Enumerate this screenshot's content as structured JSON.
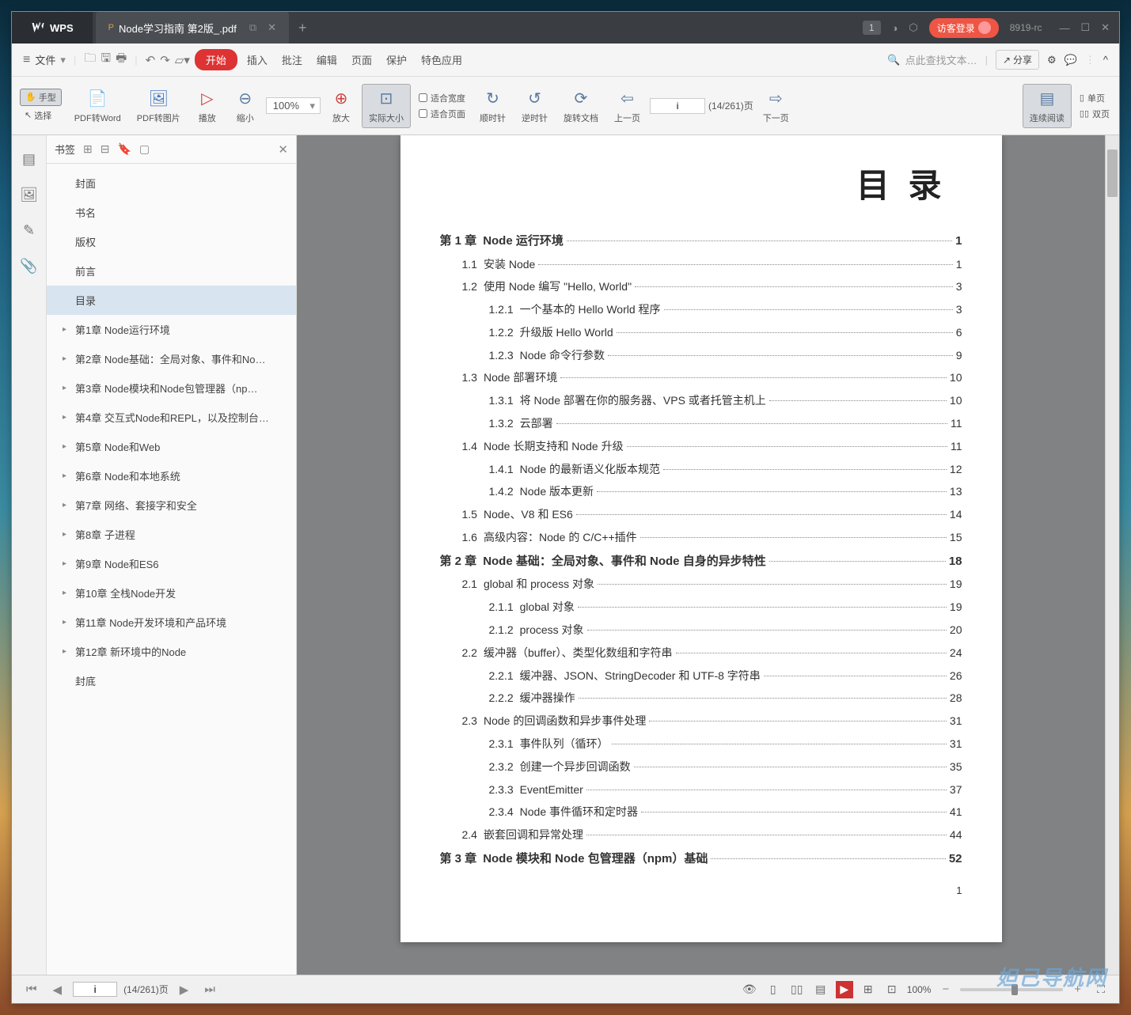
{
  "app": {
    "name": "WPS",
    "version": "8919-rc"
  },
  "tab": {
    "icon": "P",
    "title": "Node学习指南 第2版_.pdf"
  },
  "titlebar": {
    "badge": "1",
    "login": "访客登录"
  },
  "menubar": {
    "file": "文件",
    "start": "开始",
    "insert": "插入",
    "comment": "批注",
    "edit": "编辑",
    "page": "页面",
    "protect": "保护",
    "special": "特色应用",
    "search_ph": "点此查找文本…",
    "share": "分享"
  },
  "toolbar": {
    "hand": "手型",
    "select": "选择",
    "pdf2word": "PDF转Word",
    "pdf2img": "PDF转图片",
    "play": "播放",
    "shrink": "缩小",
    "zoom": "100%",
    "enlarge": "放大",
    "actual": "实际大小",
    "fit_width": "适合宽度",
    "fit_page": "适合页面",
    "cw": "顺时针",
    "ccw": "逆时针",
    "rotate": "旋转文档",
    "prev": "上一页",
    "next": "下一页",
    "page_input": "i",
    "page_info": "(14/261)页",
    "continuous": "连续阅读",
    "single": "单页",
    "double": "双页"
  },
  "sidebar": {
    "title": "书签",
    "items": [
      {
        "label": "封面",
        "exp": false
      },
      {
        "label": "书名",
        "exp": false
      },
      {
        "label": "版权",
        "exp": false
      },
      {
        "label": "前言",
        "exp": false
      },
      {
        "label": "目录",
        "exp": false,
        "active": true
      },
      {
        "label": "第1章 Node运行环境",
        "exp": true
      },
      {
        "label": "第2章 Node基础：全局对象、事件和No…",
        "exp": true
      },
      {
        "label": "第3章 Node模块和Node包管理器（np…",
        "exp": true
      },
      {
        "label": "第4章 交互式Node和REPL，以及控制台…",
        "exp": true
      },
      {
        "label": "第5章 Node和Web",
        "exp": true
      },
      {
        "label": "第6章 Node和本地系统",
        "exp": true
      },
      {
        "label": "第7章 网络、套接字和安全",
        "exp": true
      },
      {
        "label": "第8章 子进程",
        "exp": true
      },
      {
        "label": "第9章 Node和ES6",
        "exp": true
      },
      {
        "label": "第10章 全栈Node开发",
        "exp": true
      },
      {
        "label": "第11章 Node开发环境和产品环境",
        "exp": true
      },
      {
        "label": "第12章 新环境中的Node",
        "exp": true
      },
      {
        "label": "封底",
        "exp": false
      }
    ]
  },
  "doc": {
    "heading": "目 录",
    "toc": [
      {
        "l": 0,
        "n": "第 1 章",
        "t": "Node 运行环境",
        "p": "1"
      },
      {
        "l": 1,
        "n": "1.1",
        "t": "安装 Node",
        "p": "1"
      },
      {
        "l": 1,
        "n": "1.2",
        "t": "使用 Node 编写 \"Hello, World\"",
        "p": "3"
      },
      {
        "l": 2,
        "n": "1.2.1",
        "t": "一个基本的 Hello World 程序",
        "p": "3"
      },
      {
        "l": 2,
        "n": "1.2.2",
        "t": "升级版 Hello World",
        "p": "6"
      },
      {
        "l": 2,
        "n": "1.2.3",
        "t": "Node 命令行参数",
        "p": "9"
      },
      {
        "l": 1,
        "n": "1.3",
        "t": "Node 部署环境",
        "p": "10"
      },
      {
        "l": 2,
        "n": "1.3.1",
        "t": "将 Node 部署在你的服务器、VPS 或者托管主机上",
        "p": "10"
      },
      {
        "l": 2,
        "n": "1.3.2",
        "t": "云部署",
        "p": "11"
      },
      {
        "l": 1,
        "n": "1.4",
        "t": "Node 长期支持和 Node 升级",
        "p": "11"
      },
      {
        "l": 2,
        "n": "1.4.1",
        "t": "Node 的最新语义化版本规范",
        "p": "12"
      },
      {
        "l": 2,
        "n": "1.4.2",
        "t": "Node 版本更新",
        "p": "13"
      },
      {
        "l": 1,
        "n": "1.5",
        "t": "Node、V8 和 ES6",
        "p": "14"
      },
      {
        "l": 1,
        "n": "1.6",
        "t": "高级内容：Node 的 C/C++插件",
        "p": "15"
      },
      {
        "l": 0,
        "n": "第 2 章",
        "t": "Node 基础：全局对象、事件和 Node 自身的异步特性",
        "p": "18"
      },
      {
        "l": 1,
        "n": "2.1",
        "t": "global 和 process 对象",
        "p": "19"
      },
      {
        "l": 2,
        "n": "2.1.1",
        "t": "global 对象",
        "p": "19"
      },
      {
        "l": 2,
        "n": "2.1.2",
        "t": "process 对象",
        "p": "20"
      },
      {
        "l": 1,
        "n": "2.2",
        "t": "缓冲器（buffer）、类型化数组和字符串",
        "p": "24"
      },
      {
        "l": 2,
        "n": "2.2.1",
        "t": "缓冲器、JSON、StringDecoder 和 UTF-8 字符串",
        "p": "26"
      },
      {
        "l": 2,
        "n": "2.2.2",
        "t": "缓冲器操作",
        "p": "28"
      },
      {
        "l": 1,
        "n": "2.3",
        "t": "Node 的回调函数和异步事件处理",
        "p": "31"
      },
      {
        "l": 2,
        "n": "2.3.1",
        "t": "事件队列（循环）",
        "p": "31"
      },
      {
        "l": 2,
        "n": "2.3.2",
        "t": "创建一个异步回调函数",
        "p": "35"
      },
      {
        "l": 2,
        "n": "2.3.3",
        "t": "EventEmitter",
        "p": "37"
      },
      {
        "l": 2,
        "n": "2.3.4",
        "t": "Node 事件循环和定时器",
        "p": "41"
      },
      {
        "l": 1,
        "n": "2.4",
        "t": "嵌套回调和异常处理",
        "p": "44"
      },
      {
        "l": 0,
        "n": "第 3 章",
        "t": "Node 模块和 Node 包管理器（npm）基础",
        "p": "52"
      }
    ],
    "page_num": "1"
  },
  "status": {
    "page_input": "i",
    "page_info": "(14/261)页",
    "zoom": "100%"
  },
  "watermark": "妲己导航网"
}
